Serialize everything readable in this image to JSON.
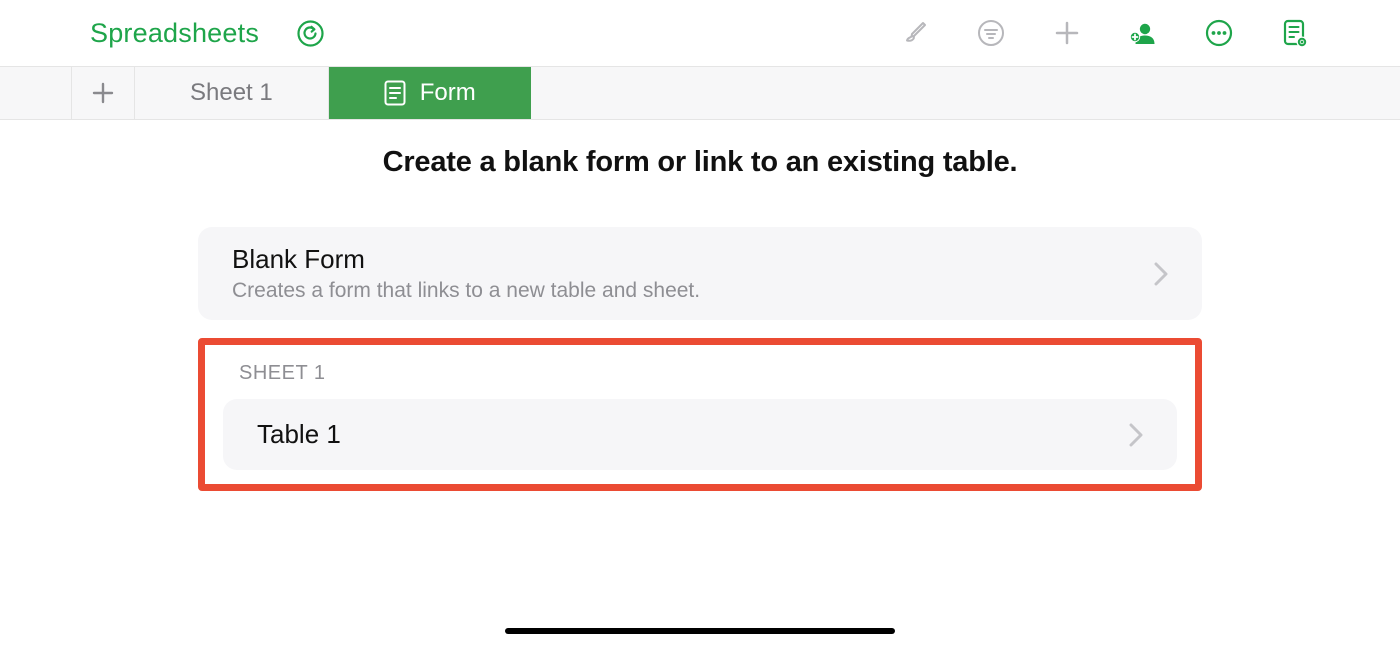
{
  "colors": {
    "accent": "#1ea54a",
    "tabActive": "#3f9f4e",
    "highlight": "#eb4b33",
    "muted": "#8e8e93",
    "iconGray": "#b7b7bb"
  },
  "topbar": {
    "brand": "Spreadsheets"
  },
  "tabs": {
    "sheet1": "Sheet 1",
    "form": "Form"
  },
  "main": {
    "heading": "Create a blank form or link to an existing table.",
    "blankForm": {
      "title": "Blank Form",
      "subtitle": "Creates a form that links to a new table and sheet."
    },
    "sectionLabel": "SHEET 1",
    "table1": {
      "title": "Table 1"
    }
  }
}
